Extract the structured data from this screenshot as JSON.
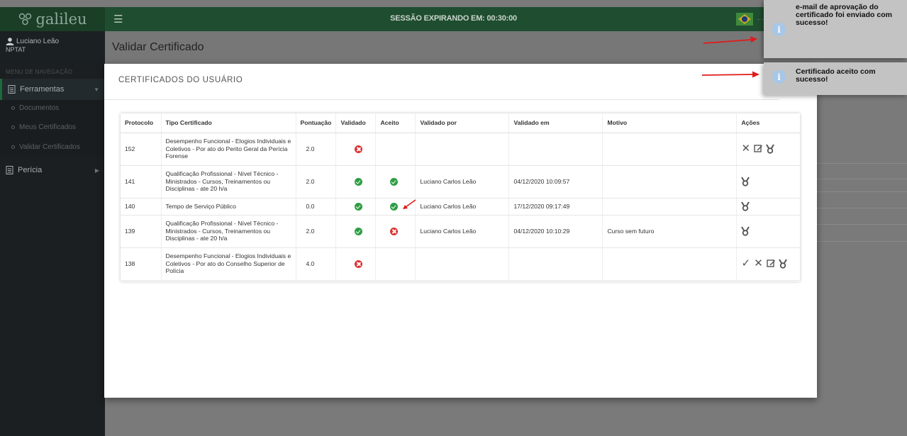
{
  "app": {
    "logo_text": "galileu"
  },
  "header": {
    "session_text": "SESSÃO EXPIRANDO EM: 00:30:00",
    "faded_text": "·· ·· ·····"
  },
  "sidebar": {
    "user_name": "Luciano Leão",
    "user_role": "NPTAT",
    "nav_heading": "MENU DE NAVEGAÇÃO",
    "items": [
      {
        "label": "Ferramentas"
      },
      {
        "label": "Perícia"
      }
    ],
    "subitems": [
      {
        "label": "Documentos"
      },
      {
        "label": "Meus Certificados"
      },
      {
        "label": "Validar Certificados"
      }
    ]
  },
  "page": {
    "title": "Validar Certificado",
    "section_title": "CERTIFICADOS DO USUÁRIO"
  },
  "table": {
    "columns": [
      "Protocolo",
      "Tipo Certificado",
      "Pontuação",
      "Validado",
      "Aceito",
      "Validado por",
      "Validado em",
      "Motivo",
      "Ações"
    ],
    "rows": [
      {
        "protocolo": "152",
        "tipo": "Desempenho Funcional - Elogios Individuais e Coletivos - Por ato do Perito Geral da Perícia Forense",
        "pontuacao": "2.0",
        "validado": "no",
        "aceito": "",
        "validado_por": "",
        "validado_em": "",
        "motivo": "",
        "acoes": [
          "reject",
          "edit",
          "medal"
        ]
      },
      {
        "protocolo": "141",
        "tipo": "Qualificação Profissional - Nível Técnico - Ministrados - Cursos, Treinamentos ou Disciplinas - ate 20 h/a",
        "pontuacao": "2.0",
        "validado": "ok",
        "aceito": "ok",
        "validado_por": "Luciano Carlos Leão",
        "validado_em": "04/12/2020 10:09:57",
        "motivo": "",
        "acoes": [
          "medal"
        ]
      },
      {
        "protocolo": "140",
        "tipo": "Tempo de Serviço Público",
        "pontuacao": "0.0",
        "validado": "ok",
        "aceito": "ok",
        "validado_por": "Luciano Carlos Leão",
        "validado_em": "17/12/2020 09:17:49",
        "motivo": "",
        "acoes": [
          "medal"
        ]
      },
      {
        "protocolo": "139",
        "tipo": "Qualificação Profissional - Nível Técnico - Ministrados - Cursos, Treinamentos ou Disciplinas - ate 20 h/a",
        "pontuacao": "2.0",
        "validado": "ok",
        "aceito": "no",
        "validado_por": "Luciano Carlos Leão",
        "validado_em": "04/12/2020 10:10:29",
        "motivo": "Curso sem futuro",
        "acoes": [
          "medal"
        ]
      },
      {
        "protocolo": "138",
        "tipo": "Desempenho Funcional - Elogios Individuais e Coletivos - Por ato do Conselho Superior de Polícia",
        "pontuacao": "4.0",
        "validado": "no",
        "aceito": "",
        "validado_por": "",
        "validado_em": "",
        "motivo": "",
        "acoes": [
          "accept",
          "reject",
          "edit",
          "medal"
        ]
      }
    ]
  },
  "notifications": [
    {
      "text": "e-mail de aprovação do certificado foi enviado com sucesso!"
    },
    {
      "text": "Certificado aceito com sucesso!"
    }
  ],
  "colors": {
    "topbar": "#1f4d2f",
    "sidebar": "#1c1f21",
    "ok": "#2e9d44",
    "no": "#d83431",
    "arrow": "#e11b1b"
  }
}
